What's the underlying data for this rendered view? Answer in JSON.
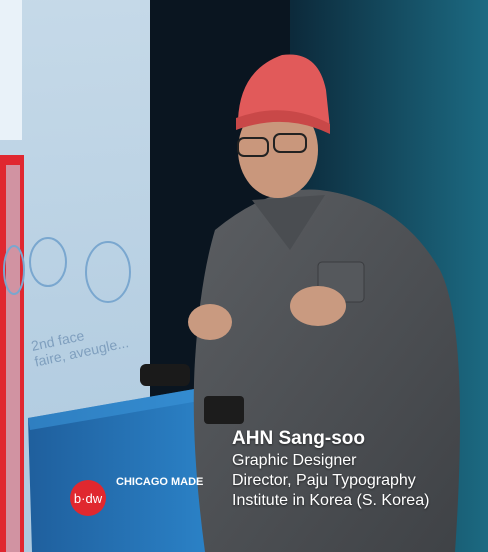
{
  "speaker": {
    "name": "AHN Sang-soo",
    "title_line_1": "Graphic Designer",
    "title_line_2": "Director, Paju Typography",
    "title_line_3": "Institute in Korea (S. Korea)"
  },
  "podium": {
    "logo_text": "b·dw",
    "sign_text": "CHICAGO MADE"
  },
  "slide": {
    "text": "2nd face\nfaire, aveugle..."
  },
  "colors": {
    "backdrop_dark": "#0b2a3a",
    "hat": "#e15a5a",
    "podium": "#2a74b8",
    "red_bar": "#e02730"
  }
}
